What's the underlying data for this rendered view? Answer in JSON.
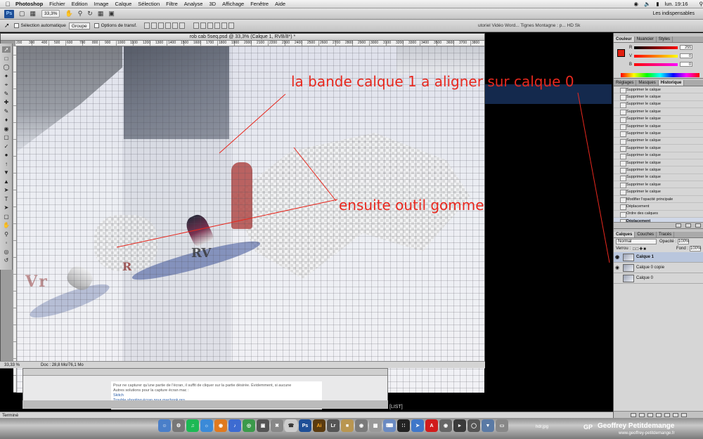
{
  "menubar": {
    "app_name": "Photoshop",
    "items": [
      "Fichier",
      "Edition",
      "Image",
      "Calque",
      "Sélection",
      "Filtre",
      "Analyse",
      "3D",
      "Affichage",
      "Fenêtre",
      "Aide"
    ],
    "clock": "lun. 19:16"
  },
  "appbar": {
    "zoom": "33,3%",
    "workspace": "Les indispensables"
  },
  "options": {
    "auto_select_label": "Sélection automatique",
    "group_value": "Groupe",
    "transform_label": "Options de transf.",
    "doc_tabs": "utoriel Vidéo Word...   Tignes Montagne : p...   HD Sk"
  },
  "document": {
    "title": "rob cab 5seq.psd @ 33,3% (Calque 1, RVB/8*) *",
    "ruler_ticks": [
      "200",
      "300",
      "400",
      "500",
      "600",
      "700",
      "800",
      "900",
      "1000",
      "1100",
      "1200",
      "1300",
      "1400",
      "1500",
      "1600",
      "1700",
      "1800",
      "1900",
      "2000",
      "2100",
      "2200",
      "2300",
      "2400",
      "2500",
      "2600",
      "2700",
      "2800",
      "2900",
      "3000",
      "3100",
      "3200",
      "3300",
      "3400",
      "3500",
      "3600",
      "3700",
      "3800"
    ],
    "zoom_status": "33,33 %",
    "doc_status": "Doc : 28,8 Mo/76,1 Mo"
  },
  "annotations": {
    "text1": "la bande calque 1 a aligner sur calque 0",
    "text2": "ensuite outil gomme",
    "color": "#e8281e"
  },
  "color_panel": {
    "tabs": [
      "Couleur",
      "Nuancier",
      "Styles"
    ],
    "r_label": "R",
    "r_value": "255",
    "v_label": "V",
    "v_value": "0",
    "b_label": "B",
    "b_value": "0",
    "fg_color": "#e02010"
  },
  "history_panel": {
    "tabs": [
      "Réglages",
      "Masques",
      "Historique"
    ],
    "items": [
      "Supprimer le calque",
      "Supprimer le calque",
      "Supprimer le calque",
      "Supprimer le calque",
      "Supprimer le calque",
      "Supprimer le calque",
      "Supprimer le calque",
      "Supprimer le calque",
      "Supprimer le calque",
      "Supprimer le calque",
      "Supprimer le calque",
      "Supprimer le calque",
      "Supprimer le calque",
      "Supprimer le calque",
      "Supprimer le calque",
      "Modifier l'opacité principale",
      "Déplacement",
      "Ordre des calques",
      "Déplacement"
    ]
  },
  "layers_panel": {
    "tabs": [
      "Calques",
      "Couches",
      "Tracés"
    ],
    "blend_mode": "Normal",
    "opacity_label": "Opacité :",
    "opacity_value": "100%",
    "lock_label": "Verrou :",
    "fill_label": "Fond :",
    "fill_value": "100%",
    "layers": [
      {
        "name": "Calque 1",
        "visible": true,
        "active": true
      },
      {
        "name": "Calque 0 copie",
        "visible": true,
        "active": false
      },
      {
        "name": "Calque 0",
        "visible": false,
        "active": false
      }
    ]
  },
  "behind_window": {
    "line1": "Pour ne capturer qu'une partie de l'écran, il suffit de cliquer sur la partie désirée. Évidemment, si aucune",
    "line2": "Autres solutions pour la capture écran mac :",
    "line3": "Skitch",
    "line4": "Trouble shooting écran pour macbook pro",
    "list_label": "[LIST]"
  },
  "status": {
    "termine": "Terminé"
  },
  "dock": {
    "filename": "hdr.jpg",
    "gp": "GP",
    "signature": "Geoffrey Petitdemange",
    "url": "www.geoffrey-petitdemange.fr"
  }
}
